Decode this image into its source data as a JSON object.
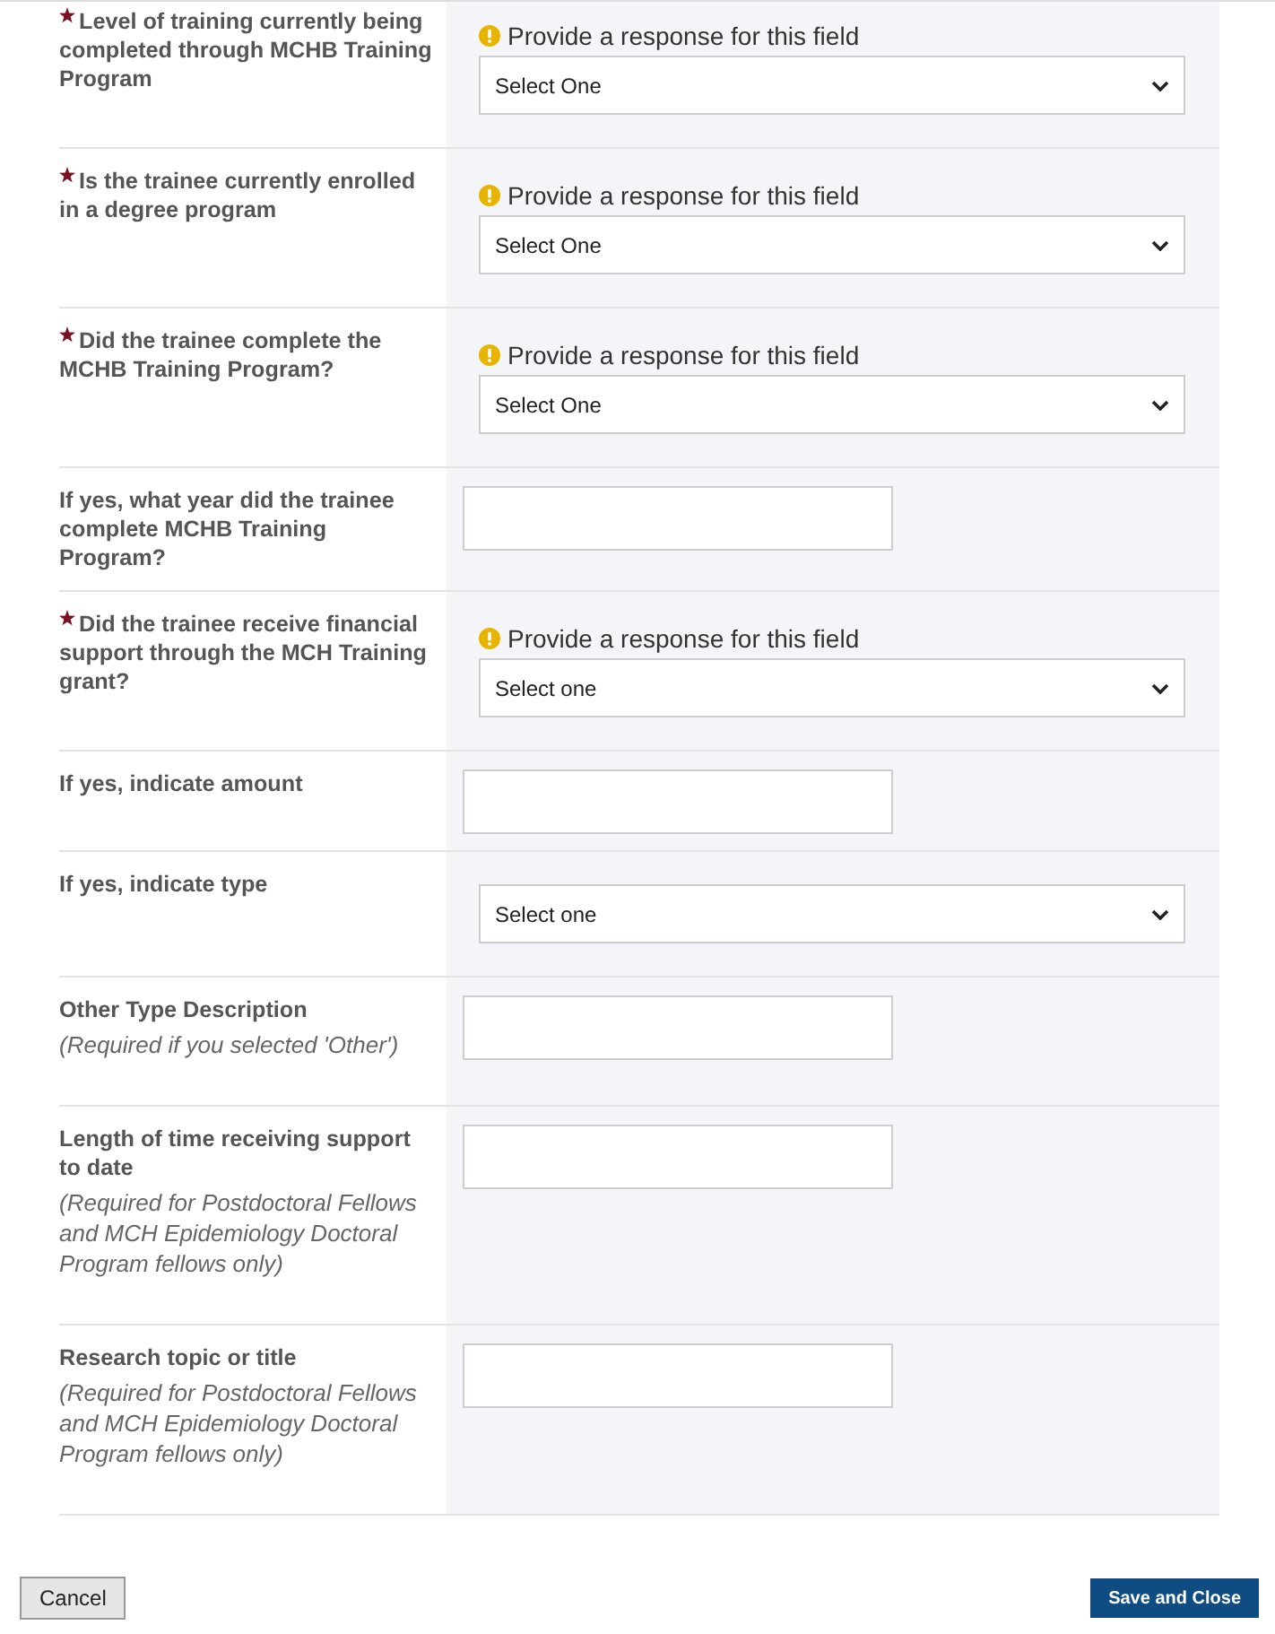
{
  "rows": [
    {
      "kind": "select",
      "required": true,
      "label": "Level of training currently being completed through MCHB Training Program",
      "warning": "Provide a response for this field",
      "value": "Select One"
    },
    {
      "kind": "select",
      "required": true,
      "label": "Is the trainee currently enrolled in a degree program",
      "warning": "Provide a response for this field",
      "value": "Select One"
    },
    {
      "kind": "select",
      "required": true,
      "label": "Did the trainee complete the MCHB Training Program?",
      "warning": "Provide a response for this field",
      "value": "Select One"
    },
    {
      "kind": "text",
      "required": false,
      "label": "If yes, what year did the trainee complete MCHB Training Program?"
    },
    {
      "kind": "select",
      "required": true,
      "label": "Did the trainee receive financial support through the MCH Training grant?",
      "warning": "Provide a response for this field",
      "value": "Select one"
    },
    {
      "kind": "text",
      "required": false,
      "label": "If yes, indicate amount"
    },
    {
      "kind": "select",
      "required": false,
      "label": "If yes, indicate type",
      "value": "Select one"
    },
    {
      "kind": "text",
      "required": false,
      "label": "Other Type Description",
      "hint": "(Required if you selected 'Other')"
    },
    {
      "kind": "text",
      "required": false,
      "label": "Length of time receiving support to date",
      "hint": "(Required for Postdoctoral Fellows and MCH Epidemiology Doctoral Program fellows only)"
    },
    {
      "kind": "text",
      "required": false,
      "label": "Research topic or title",
      "hint": "(Required for Postdoctoral Fellows and MCH Epidemiology Doctoral Program fellows only)"
    }
  ],
  "buttons": {
    "cancel": "Cancel",
    "save": "Save and Close"
  }
}
